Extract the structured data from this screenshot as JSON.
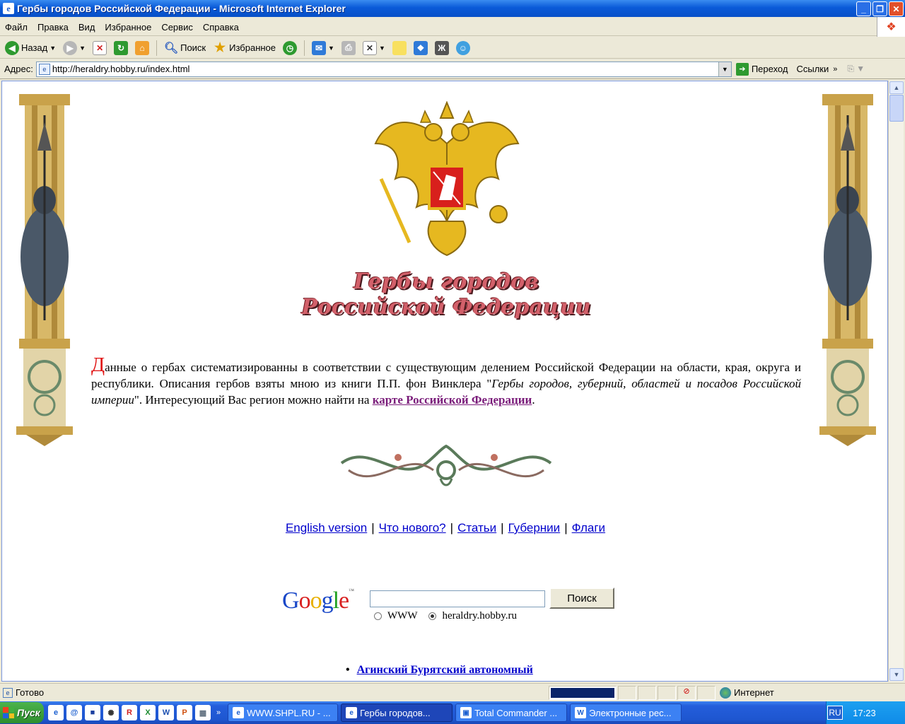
{
  "window": {
    "title": "Гербы городов Российской Федерации - Microsoft Internet Explorer"
  },
  "menu": [
    "Файл",
    "Правка",
    "Вид",
    "Избранное",
    "Сервис",
    "Справка"
  ],
  "toolbar": {
    "back_label": "Назад",
    "search_label": "Поиск",
    "favorites_label": "Избранное"
  },
  "address": {
    "label": "Адрес:",
    "url": "http://heraldry.hobby.ru/index.html",
    "go_label": "Переход",
    "links_label": "Ссылки"
  },
  "page": {
    "heading_line1": "Гербы городов",
    "heading_line2": "Российской Федерации",
    "intro": {
      "cap": "Д",
      "text1": "анные о гербах систематизированны в соответствии с существующим делением Российской Федерации на области, края, округа и республики. Описания гербов взяты мною из книги П.П. фон Винклера \"",
      "book_title": "Гербы городов, губерний, областей и посадов Российской империи",
      "text2": "\". Интересующий Вас регион можно найти на ",
      "map_link": "карте Российской Федерации",
      "end": "."
    },
    "nav_links": [
      "English version",
      "Что нового?",
      "Статьи",
      "Губернии",
      "Флаги"
    ],
    "google": {
      "search_button": "Поиск",
      "radio_www": "WWW",
      "radio_site": "heraldry.hobby.ru"
    },
    "regions": [
      "Агинский Бурятский автономный"
    ]
  },
  "status": {
    "text": "Готово",
    "zone": "Интернет"
  },
  "taskbar": {
    "start": "Пуск",
    "tasks": [
      "WWW.SHPL.RU - ...",
      "Гербы городов...",
      "Total Commander ...",
      "Электронные рес..."
    ],
    "lang": "RU",
    "clock": "17:23"
  },
  "colors": {
    "titlebar": "#0a5ad8",
    "heading": "#d2606a",
    "drop_cap": "#e01010",
    "visited_link": "#7a1c7a",
    "link": "#0000cc"
  }
}
